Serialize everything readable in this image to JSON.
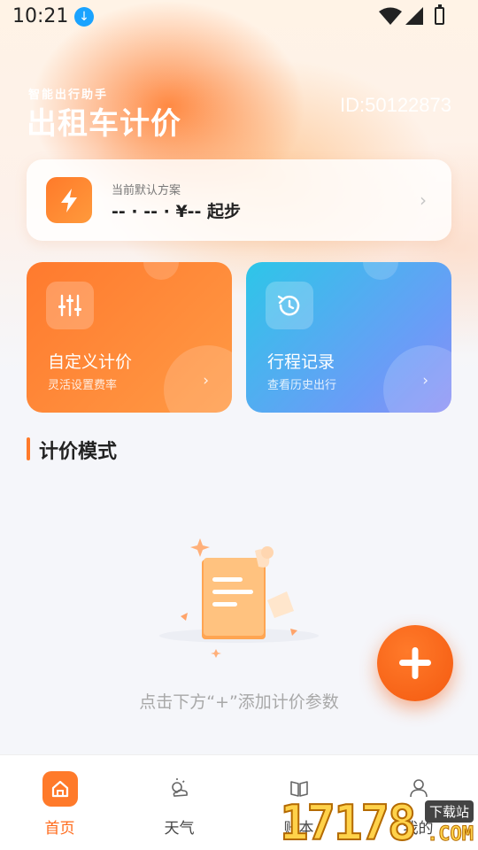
{
  "status_bar": {
    "time": "10:21"
  },
  "header": {
    "subtitle": "智能出行助手",
    "title": "出租车计价",
    "user_id": "ID:50122873"
  },
  "default_plan": {
    "label": "当前默认方案",
    "value": "-- · -- · ¥-- 起步"
  },
  "features": [
    {
      "title": "自定义计价",
      "subtitle": "灵活设置费率",
      "icon": "sliders-icon"
    },
    {
      "title": "行程记录",
      "subtitle": "查看历史出行",
      "icon": "history-icon"
    }
  ],
  "section": {
    "title": "计价模式"
  },
  "empty_state": {
    "text": "点击下方“+”添加计价参数"
  },
  "bottom_nav": {
    "items": [
      {
        "label": "首页",
        "icon": "home-icon",
        "active": true
      },
      {
        "label": "天气",
        "icon": "weather-icon",
        "active": false
      },
      {
        "label": "账本",
        "icon": "book-icon",
        "active": false
      },
      {
        "label": "我的",
        "icon": "user-icon",
        "active": false
      }
    ]
  },
  "watermark": {
    "text": "17178",
    "badge": "下载站",
    "suffix": ".COM"
  },
  "colors": {
    "accent": "#ff7a2a",
    "trip_card": "#2dc6e8",
    "text_muted": "#a8a8a8"
  }
}
